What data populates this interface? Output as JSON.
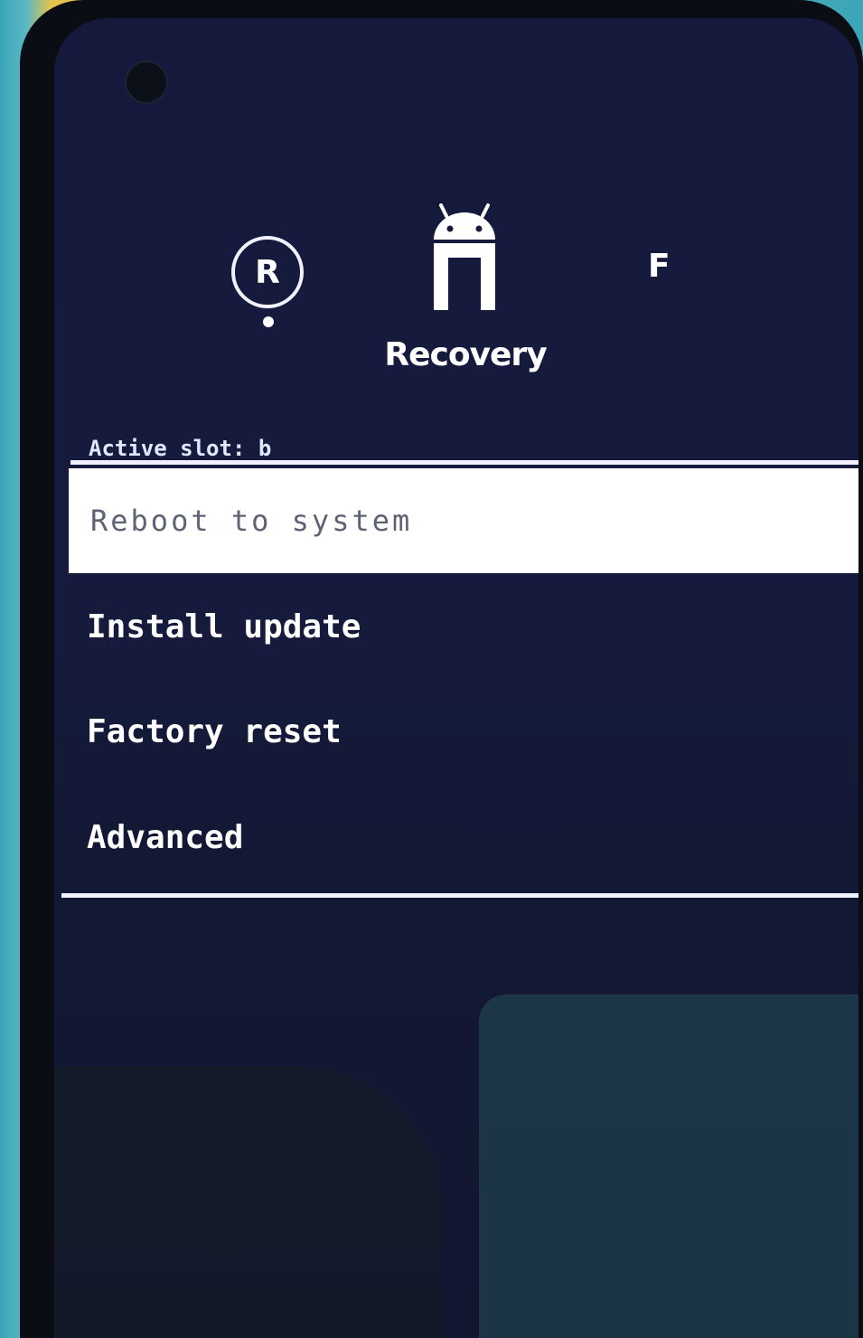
{
  "header": {
    "left_badge": "R",
    "right_badge": "F",
    "mode_label": "Recovery"
  },
  "status": {
    "active_slot": "Active slot: b"
  },
  "menu": {
    "items": [
      {
        "label": "Reboot to system",
        "selected": true
      },
      {
        "label": "Install update",
        "selected": false
      },
      {
        "label": "Factory reset",
        "selected": false
      },
      {
        "label": "Advanced",
        "selected": false
      }
    ]
  },
  "colors": {
    "background": "#151a3c",
    "highlight": "#ffffff",
    "text": "#ffffff"
  }
}
